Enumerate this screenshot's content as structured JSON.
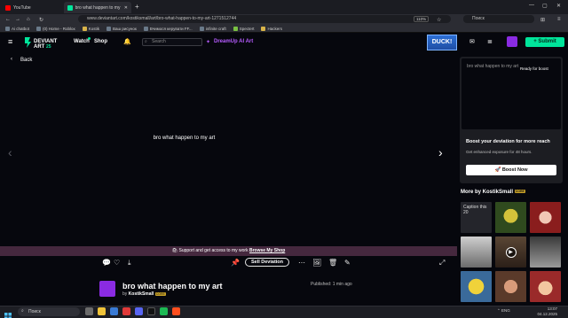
{
  "browser": {
    "tabs": [
      {
        "label": "YouTube",
        "color": "#ff0000"
      },
      {
        "label": "bro what happen to my art by",
        "color": "#00e59b"
      }
    ],
    "address": "www.deviantart.com/kostiksmall/art/bro-what-happen-to-my-art-1271512744",
    "zoom": "110%",
    "search_placeholder": "Поиск",
    "bookmarks": [
      "Ai chatbot",
      "(0) Home - Roblox",
      "Kostik",
      "Ваш рисунок",
      "Вчимося керувати FF...",
      "infinite craft",
      "Spectert",
      "Hackers"
    ]
  },
  "header": {
    "logo_text": "DEVIANT ART",
    "watch": "Watch",
    "shop": "Shop",
    "search_placeholder": "Search",
    "dreamup": "DreamUp AI Art",
    "ad_text": "DUCK!",
    "submit": "+ Submit"
  },
  "stage": {
    "back": "Back",
    "art_text": "bro what happen to my art",
    "shop_bar_text": "Support and get access to my work",
    "shop_bar_link": "Browse My Shop",
    "sell_label": "Sell Deviation"
  },
  "deviation": {
    "title": "bro what happen to my art",
    "by": "by",
    "author": "KostikSmall",
    "badge": "CORE",
    "published": "Published: 1 min ago"
  },
  "sidebar": {
    "boost_label": "bro what happen to my art",
    "boost_ready": "Ready for boost",
    "boost_title": "Boost your deviation for more reach",
    "boost_sub": "Get enhanced exposure for 48 hours.",
    "boost_button": "Boost Now",
    "more_by": "More by KostikSmall",
    "more_badge": "CORE",
    "caption_thumb": "Caption this 20"
  },
  "taskbar": {
    "search": "Поиск",
    "lang": "ENG",
    "time": "13:07",
    "date": "04.12.2025"
  }
}
